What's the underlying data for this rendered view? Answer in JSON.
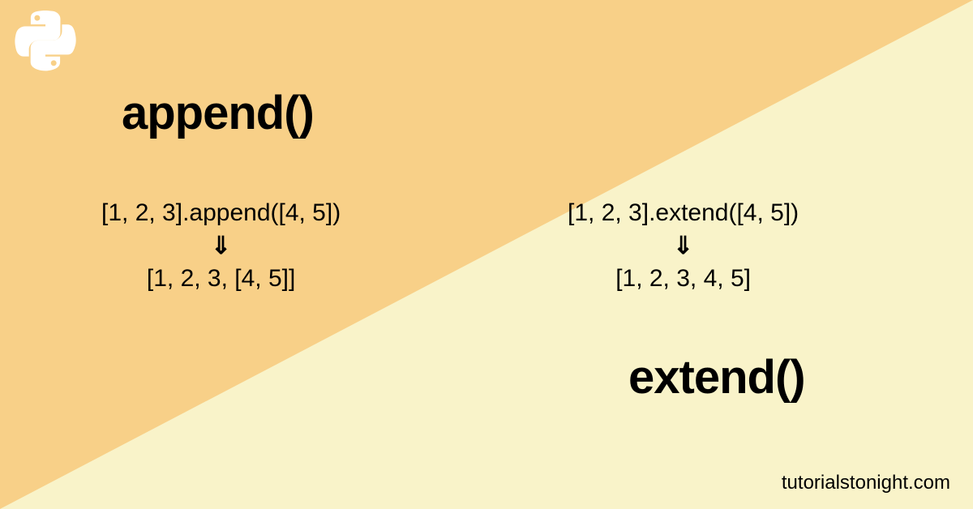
{
  "logo": {
    "name": "python-logo"
  },
  "left": {
    "title": "append()",
    "code": "[1, 2, 3].append([4, 5])",
    "arrow": "⇓",
    "result": "[1, 2, 3, [4, 5]]"
  },
  "right": {
    "title": "extend()",
    "code": "[1, 2, 3].extend([4, 5])",
    "arrow": "⇓",
    "result": "[1, 2, 3, 4, 5]"
  },
  "footer": "tutorialstonight.com"
}
